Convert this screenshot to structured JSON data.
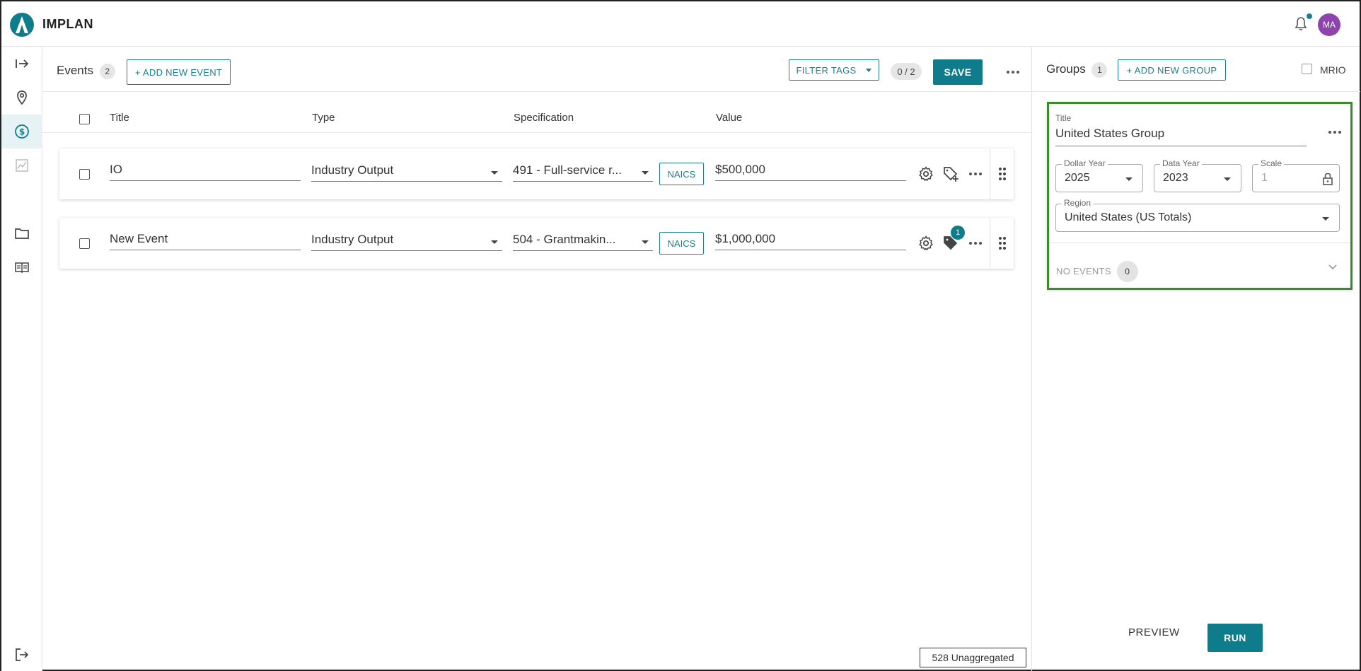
{
  "app": {
    "brand": "IMPLAN",
    "user_initials": "MA"
  },
  "colors": {
    "accent": "#0e7c8b",
    "avatar": "#8e44ad",
    "highlight_border": "#3a8c2a"
  },
  "rail": {
    "items": [
      {
        "icon": "expand-arrow-icon"
      },
      {
        "icon": "location-pin-icon"
      },
      {
        "icon": "dollar-circle-icon",
        "active": true
      },
      {
        "icon": "chart-line-icon",
        "disabled": true
      },
      {
        "icon": "folder-icon"
      },
      {
        "icon": "book-icon"
      },
      {
        "icon": "logout-icon"
      }
    ]
  },
  "events": {
    "title": "Events",
    "count": "2",
    "add_label": "+ ADD NEW EVENT",
    "filter_label": "FILTER TAGS",
    "selection_count": "0 / 2",
    "save_label": "SAVE",
    "columns": {
      "title": "Title",
      "type": "Type",
      "specification": "Specification",
      "value": "Value"
    },
    "rows": [
      {
        "title": "IO",
        "type": "Industry Output",
        "specification": "491 - Full-service r...",
        "code_label": "NAICS",
        "value": "$500,000",
        "tag_count": ""
      },
      {
        "title": "New Event",
        "type": "Industry Output",
        "specification": "504 - Grantmakin...",
        "code_label": "NAICS",
        "value": "$1,000,000",
        "tag_count": "1"
      }
    ],
    "unaggregated": "528 Unaggregated"
  },
  "groups": {
    "title": "Groups",
    "count": "1",
    "add_label": "+ ADD NEW GROUP",
    "mrio_label": "MRIO",
    "group": {
      "title_label": "Title",
      "title_value": "United States Group",
      "dollar_year_label": "Dollar Year",
      "dollar_year": "2025",
      "data_year_label": "Data Year",
      "data_year": "2023",
      "scale_label": "Scale",
      "scale": "1",
      "region_label": "Region",
      "region": "United States (US Totals)",
      "no_events_label": "NO EVENTS",
      "events_count": "0"
    },
    "preview_label": "PREVIEW",
    "run_label": "RUN"
  }
}
